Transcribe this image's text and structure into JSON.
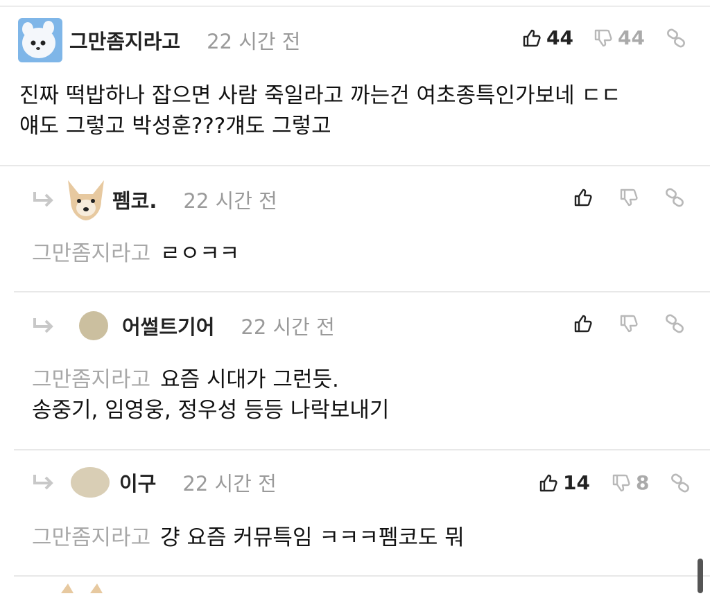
{
  "comments": [
    {
      "nickname": "그만좀지라고",
      "time": "22 시간 전",
      "lines": [
        "진짜 떡밥하나 잡으면 사람 죽일라고 까는건 여초종특인가보네 ㄷㄷ",
        "얘도 그렇고 박성훈???걔도 그렇고"
      ],
      "likes": "44",
      "dislikes": "44"
    }
  ],
  "replies": [
    {
      "nickname": "펨코.",
      "time": "22 시간 전",
      "mention": "그만좀지라고",
      "lines": [
        "ㄹㅇㅋㅋ"
      ],
      "likes": "",
      "dislikes": ""
    },
    {
      "nickname": "어썰트기어",
      "time": "22 시간 전",
      "mention": "그만좀지라고",
      "lines": [
        "요즘 시대가 그런듯.",
        "송중기, 임영웅, 정우성 등등 나락보내기"
      ],
      "likes": "",
      "dislikes": ""
    },
    {
      "nickname": "이구",
      "time": "22 시간 전",
      "mention": "그만좀지라고",
      "lines": [
        "걍 요즘 커뮤특임 ㅋㅋㅋ펨코도 뭐"
      ],
      "likes": "14",
      "dislikes": "8"
    }
  ],
  "icons": {
    "like": "thumbs-up-icon",
    "dislike": "thumbs-down-icon",
    "link": "link-icon",
    "reply": "reply-arrow-icon"
  },
  "colors": {
    "muted": "#9a9a9a",
    "mention": "#a8a8a8",
    "divider": "#e8e8e8"
  }
}
